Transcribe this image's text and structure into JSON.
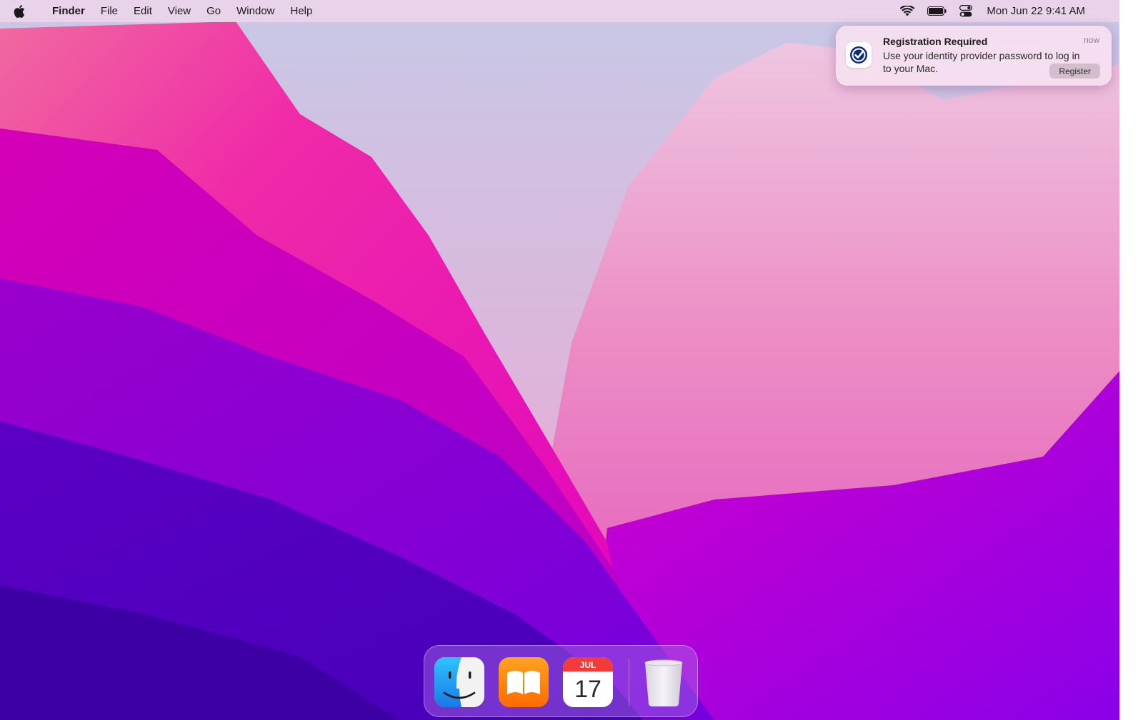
{
  "menubar": {
    "apple_icon": "apple-logo-icon",
    "app_name": "Finder",
    "items": [
      "File",
      "Edit",
      "View",
      "Go",
      "Window",
      "Help"
    ],
    "status_icons": [
      "wifi-icon",
      "battery-icon",
      "control-center-icon"
    ],
    "clock": "Mon Jun 22  9:41 AM"
  },
  "notification": {
    "icon": "checkmark-badge-icon",
    "title": "Registration Required",
    "body": "Use your identity provider password to log in to your Mac.",
    "time": "now",
    "button_label": "Register"
  },
  "dock": {
    "apps": [
      {
        "name": "Finder",
        "icon": "finder-icon"
      },
      {
        "name": "Books",
        "icon": "books-icon"
      },
      {
        "name": "Calendar",
        "icon": "calendar-icon",
        "month": "JUL",
        "day": "17"
      },
      {
        "name": "Trash",
        "icon": "trash-icon"
      }
    ]
  },
  "colors": {
    "wallpaper_magenta": "#e000b8",
    "wallpaper_purple": "#6a00d8",
    "notification_icon_blue": "#0b2a7a",
    "calendar_red": "#f23b3b"
  }
}
